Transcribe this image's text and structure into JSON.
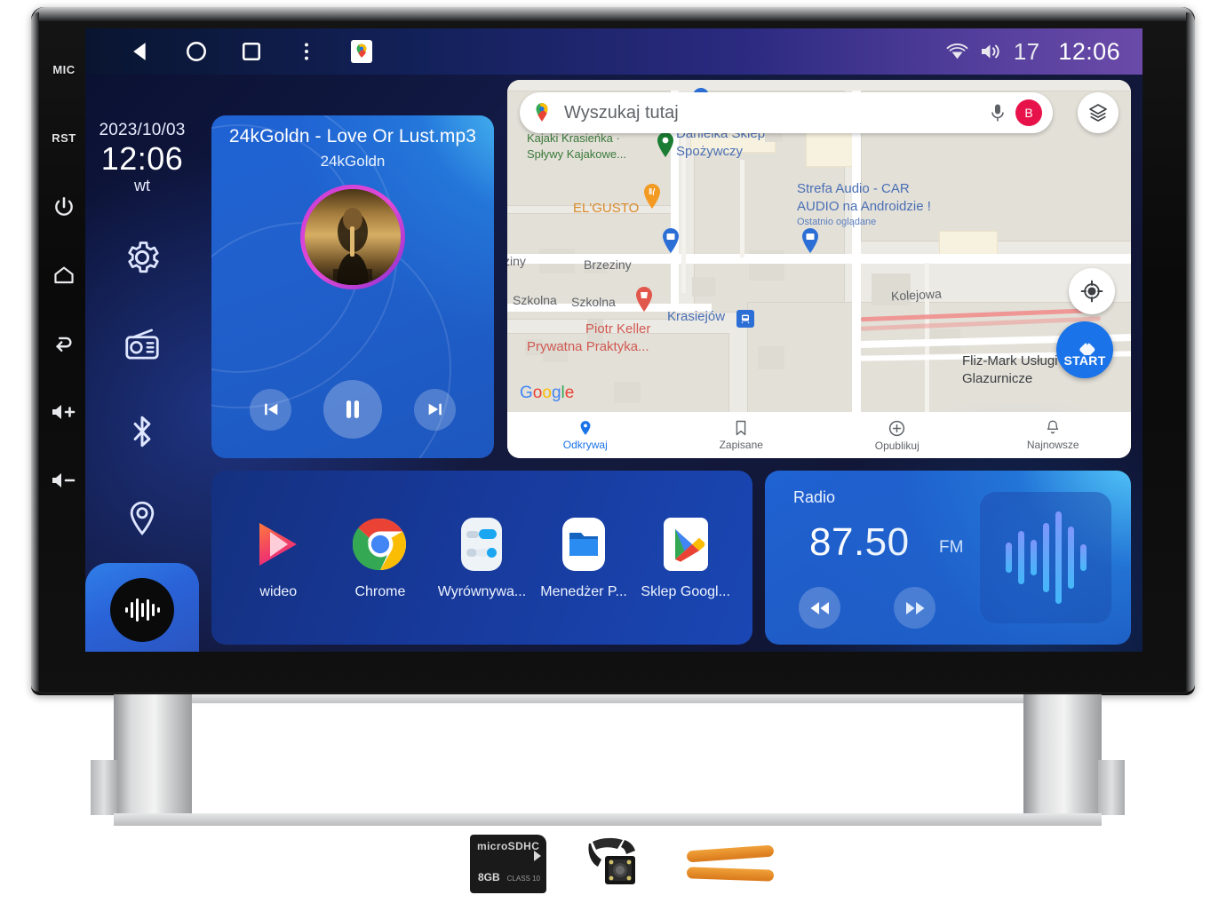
{
  "statusbar": {
    "icons": [
      "back-icon",
      "home-circle-icon",
      "recents-square-icon",
      "overflow-menu-icon",
      "google-maps-icon"
    ],
    "wifi_icon": "wifi-icon",
    "volume_icon": "volume-icon",
    "volume_level": "17",
    "clock": "12:06"
  },
  "hardkeys": [
    {
      "name": "mic",
      "label": "MIC"
    },
    {
      "name": "reset",
      "label": "RST"
    },
    {
      "name": "power",
      "label": ""
    },
    {
      "name": "home",
      "label": ""
    },
    {
      "name": "back",
      "label": ""
    },
    {
      "name": "volume-up",
      "label": ""
    },
    {
      "name": "volume-down",
      "label": ""
    }
  ],
  "dock": {
    "date": "2023/10/03",
    "time": "12:06",
    "weekday": "wt",
    "icons": [
      "settings-gear-icon",
      "radio-icon",
      "bluetooth-icon",
      "location-pin-icon"
    ],
    "now_playing_icon": "audio-waveform-icon"
  },
  "music": {
    "title": "24kGoldn - Love Or Lust.mp3",
    "artist": "24kGoldn",
    "album_art": "album-cover-art",
    "prev_icon": "skip-previous-icon",
    "play_icon": "pause-icon",
    "next_icon": "skip-next-icon"
  },
  "map": {
    "search_placeholder": "Wyszukaj tutaj",
    "maps_icon": "google-maps-pin-icon",
    "mic_icon": "microphone-icon",
    "avatar_letter": "B",
    "layers_icon": "map-layers-icon",
    "locate_icon": "my-location-icon",
    "start_label": "START",
    "start_icon": "navigation-arrow-icon",
    "attribution": "Google",
    "labels": [
      {
        "text": "Kajaki Krasieńka ·",
        "color": "green"
      },
      {
        "text": "Spływy Kajakowe...",
        "color": "green"
      },
      {
        "text": "Danielka Sklep",
        "color": "blue"
      },
      {
        "text": "Spożywczy",
        "color": "blue"
      },
      {
        "text": "Strefa Audio - CAR",
        "color": "blue"
      },
      {
        "text": "AUDIO na Androidzie !",
        "color": "blue"
      },
      {
        "text": "Ostatnio oglądane",
        "color": "sub"
      },
      {
        "text": "EL'GUSTO",
        "color": "orange"
      },
      {
        "text": "Brzeziny",
        "color": "street"
      },
      {
        "text": "ziny",
        "color": "street"
      },
      {
        "text": "Szkolna",
        "color": "street"
      },
      {
        "text": "Kolejowa",
        "color": "street"
      },
      {
        "text": "Krasiejów",
        "color": "blue"
      },
      {
        "text": "Piotr Keller",
        "color": "red"
      },
      {
        "text": "Prywatna Praktyka...",
        "color": "red"
      },
      {
        "text": "Fliz-Mark Usługi",
        "color": "street"
      },
      {
        "text": "Glazurnicze",
        "color": "street"
      }
    ],
    "bottom_nav": [
      {
        "label": "Odkrywaj",
        "icon": "explore-pin-icon",
        "active": true
      },
      {
        "label": "Zapisane",
        "icon": "bookmark-icon",
        "active": false
      },
      {
        "label": "Opublikuj",
        "icon": "contribute-plus-icon",
        "active": false
      },
      {
        "label": "Najnowsze",
        "icon": "bell-updates-icon",
        "active": false
      }
    ]
  },
  "apps": [
    {
      "label": "wideo",
      "icon": "video-player-icon"
    },
    {
      "label": "Chrome",
      "icon": "chrome-icon"
    },
    {
      "label": "Wyrównywa...",
      "icon": "equalizer-icon"
    },
    {
      "label": "Menedżer P...",
      "icon": "file-manager-icon"
    },
    {
      "label": "Sklep Googl...",
      "icon": "google-play-icon"
    }
  ],
  "radio": {
    "title": "Radio",
    "frequency": "87.50",
    "band": "FM",
    "prev_icon": "rewind-icon",
    "next_icon": "fast-forward-icon",
    "visual_icon": "audio-waveform-icon",
    "bars": [
      34,
      60,
      40,
      78,
      104,
      70,
      30
    ]
  },
  "accessories": [
    {
      "name": "microsd-card",
      "capacity": "8GB",
      "brand": "microSDHC",
      "class": "CLASS 10"
    },
    {
      "name": "rear-view-camera"
    },
    {
      "name": "pry-tools"
    }
  ],
  "colors": {
    "accent_blue": "#1a73e8",
    "card_blue": "#1f62d2",
    "status_purple": "#6b4aa8",
    "avatar_pink": "#e8124a"
  }
}
